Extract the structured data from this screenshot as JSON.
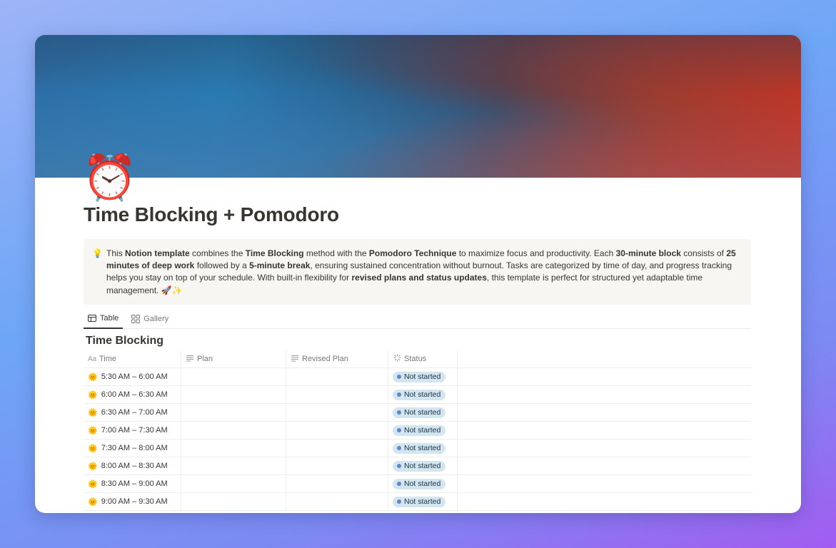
{
  "page": {
    "icon": "alarm-clock-icon",
    "icon_glyph": "⏰",
    "title": "Time Blocking + Pomodoro"
  },
  "callout": {
    "icon": "lightbulb-icon",
    "icon_glyph": "💡",
    "segments": [
      {
        "text": "This ",
        "bold": false
      },
      {
        "text": "Notion template",
        "bold": true
      },
      {
        "text": " combines the ",
        "bold": false
      },
      {
        "text": "Time Blocking",
        "bold": true
      },
      {
        "text": " method with the ",
        "bold": false
      },
      {
        "text": "Pomodoro Technique",
        "bold": true
      },
      {
        "text": " to maximize focus and productivity. Each ",
        "bold": false
      },
      {
        "text": "30-minute block",
        "bold": true
      },
      {
        "text": " consists of ",
        "bold": false
      },
      {
        "text": "25 minutes of deep work",
        "bold": true
      },
      {
        "text": " followed by a ",
        "bold": false
      },
      {
        "text": "5-minute break",
        "bold": true
      },
      {
        "text": ", ensuring sustained concentration without burnout. Tasks are categorized by time of day, and progress tracking helps you stay on top of your schedule. With built-in flexibility for ",
        "bold": false
      },
      {
        "text": "revised plans and status updates",
        "bold": true
      },
      {
        "text": ", this template is perfect for structured yet adaptable time management. 🚀✨",
        "bold": false
      }
    ]
  },
  "tabs": [
    {
      "label": "Table",
      "icon": "table-icon",
      "active": true
    },
    {
      "label": "Gallery",
      "icon": "gallery-icon",
      "active": false
    }
  ],
  "database": {
    "title": "Time Blocking",
    "columns": {
      "time": {
        "label": "Time",
        "icon_text": "Aa"
      },
      "plan": {
        "label": "Plan",
        "icon": "text-lines-icon"
      },
      "revised": {
        "label": "Revised Plan",
        "icon": "text-lines-icon"
      },
      "status": {
        "label": "Status",
        "icon": "status-spinner-icon"
      }
    },
    "rows": [
      {
        "icon": "sun-icon",
        "glyph": "🌞",
        "time": "5:30 AM – 6:00 AM",
        "plan": "",
        "revised": "",
        "status": "Not started"
      },
      {
        "icon": "sun-icon",
        "glyph": "🌞",
        "time": "6:00 AM – 6:30 AM",
        "plan": "",
        "revised": "",
        "status": "Not started"
      },
      {
        "icon": "sun-icon",
        "glyph": "🌞",
        "time": "6:30 AM – 7:00 AM",
        "plan": "",
        "revised": "",
        "status": "Not started"
      },
      {
        "icon": "sun-icon",
        "glyph": "🌞",
        "time": "7:00 AM – 7:30 AM",
        "plan": "",
        "revised": "",
        "status": "Not started"
      },
      {
        "icon": "sun-icon",
        "glyph": "🌞",
        "time": "7:30 AM – 8:00 AM",
        "plan": "",
        "revised": "",
        "status": "Not started"
      },
      {
        "icon": "sun-icon",
        "glyph": "🌞",
        "time": "8:00 AM – 8:30 AM",
        "plan": "",
        "revised": "",
        "status": "Not started"
      },
      {
        "icon": "sun-icon",
        "glyph": "🌞",
        "time": "8:30 AM – 9:00 AM",
        "plan": "",
        "revised": "",
        "status": "Not started"
      },
      {
        "icon": "sun-icon",
        "glyph": "🌞",
        "time": "9:00 AM – 9:30 AM",
        "plan": "",
        "revised": "",
        "status": "Not started"
      }
    ]
  },
  "colors": {
    "status_badge_bg": "#d3e5ef",
    "status_dot": "#5e87c9",
    "text": "#37352f",
    "muted": "#787774"
  }
}
